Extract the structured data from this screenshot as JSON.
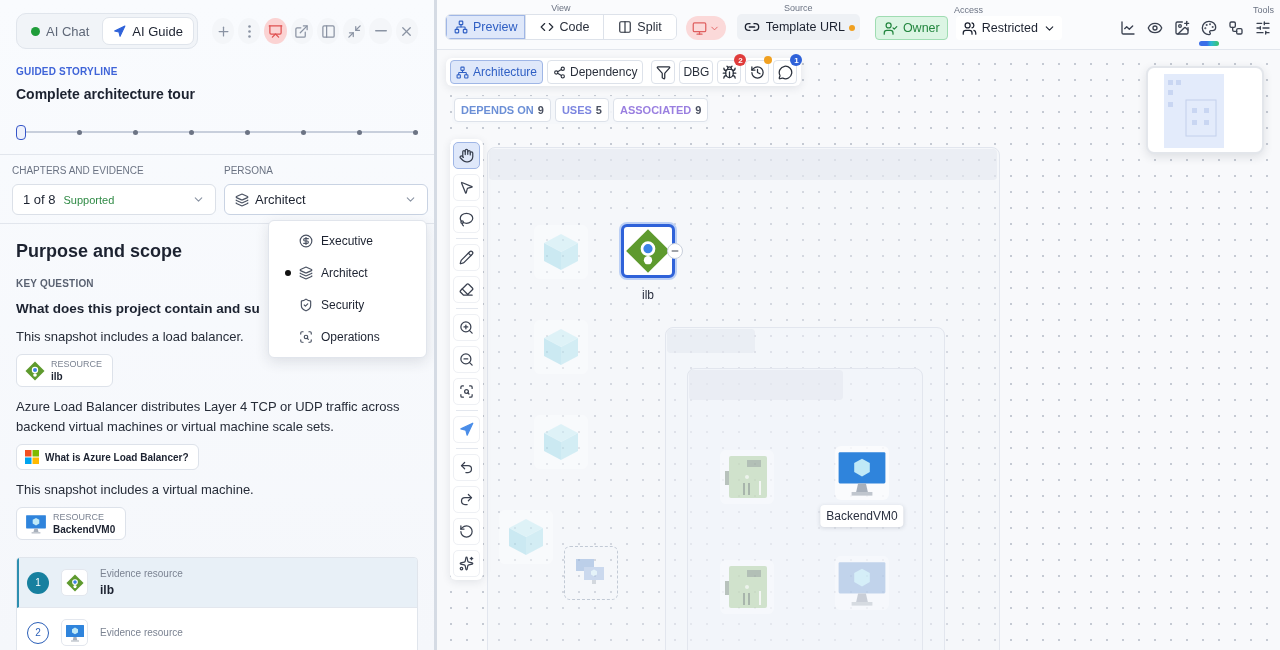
{
  "left_panel": {
    "mode_tabs": [
      {
        "label": "AI Chat",
        "selected": false
      },
      {
        "label": "AI Guide",
        "selected": true
      }
    ],
    "header_actions": [
      {
        "kind": "add",
        "active": false
      },
      {
        "kind": "more",
        "active": false
      },
      {
        "kind": "present",
        "active": true
      },
      {
        "kind": "popout",
        "active": false
      },
      {
        "kind": "panel",
        "active": false
      },
      {
        "kind": "collapse",
        "active": false
      },
      {
        "kind": "minimize",
        "active": false
      },
      {
        "kind": "close",
        "active": false
      }
    ],
    "storyline": {
      "eyebrow": "GUIDED STORYLINE",
      "title": "Complete architecture tour",
      "steps": [
        {
          "selected": true
        },
        {
          "selected": false
        },
        {
          "selected": false
        },
        {
          "selected": false
        },
        {
          "selected": false
        },
        {
          "selected": false
        },
        {
          "selected": false
        },
        {
          "selected": false
        }
      ]
    },
    "chapter_select": {
      "label": "CHAPTERS AND EVIDENCE",
      "value": "1 of 8",
      "status": "Supported"
    },
    "persona_select": {
      "label": "PERSONA",
      "value": "Architect",
      "expanded": true,
      "options": [
        {
          "label": "Executive",
          "kind": "executive",
          "selected": false
        },
        {
          "label": "Architect",
          "kind": "architect",
          "selected": true
        },
        {
          "label": "Security",
          "kind": "security",
          "selected": false
        },
        {
          "label": "Operations",
          "kind": "operations",
          "selected": false
        }
      ]
    },
    "section": {
      "title": "Purpose and scope",
      "eyebrow": "KEY QUESTION",
      "question": "What does this project contain and su",
      "blocks": [
        {
          "kind": "text",
          "text": "This snapshot includes a load balancer."
        },
        {
          "kind": "lb_resource",
          "label": "RESOURCE",
          "name": "ilb"
        },
        {
          "kind": "text",
          "text": "Azure Load Balancer distributes Layer 4 TCP or UDP traffic across backend virtual machines or virtual machine scale sets."
        },
        {
          "kind": "doc_link",
          "text": "What is Azure Load Balancer?"
        },
        {
          "kind": "text",
          "text": "This snapshot includes a virtual machine."
        },
        {
          "kind": "vm_resource",
          "label": "RESOURCE",
          "name": "BackendVM0"
        }
      ]
    },
    "evidence": [
      {
        "number": "1",
        "caption": "Evidence resource",
        "name": "ilb",
        "kind": "lb",
        "selected": true
      },
      {
        "number": "2",
        "caption": "Evidence resource",
        "kind": "vm",
        "selected": false
      }
    ]
  },
  "right_panel": {
    "view": {
      "label": "View",
      "options": [
        {
          "label": "Preview",
          "kind": "preview",
          "selected": true
        },
        {
          "label": "Code",
          "kind": "code",
          "selected": false
        },
        {
          "label": "Split",
          "kind": "split",
          "selected": false
        }
      ]
    },
    "device_preview": {
      "active": true
    },
    "source": {
      "label": "Source",
      "button": "Template URL",
      "unsaved": true
    },
    "access": {
      "label": "Access",
      "role": "Owner",
      "visibility": "Restricted"
    },
    "tools": {
      "label": "Tools",
      "items": [
        {
          "kind": "chart"
        },
        {
          "kind": "eye"
        },
        {
          "kind": "image"
        },
        {
          "kind": "palette"
        },
        {
          "kind": "flow"
        },
        {
          "kind": "sliders"
        }
      ]
    },
    "canvas": {
      "modes": [
        {
          "label": "Architecture",
          "kind": "architecture",
          "selected": true
        },
        {
          "label": "Dependency",
          "kind": "dependency",
          "selected": false
        }
      ],
      "debug_label": "DBG",
      "issue_count": "2",
      "history_pending": true,
      "comment_count": "1",
      "relation_chips": [
        {
          "label": "DEPENDS ON",
          "count": "9",
          "color": "#6b8fd6"
        },
        {
          "label": "USES",
          "count": "5",
          "color": "#7d86e0"
        },
        {
          "label": "ASSOCIATED",
          "count": "9",
          "color": "#9a7fe0"
        }
      ],
      "tools": [
        {
          "kind": "hand",
          "selected": true
        },
        {
          "kind": "pointer",
          "selected": false
        },
        {
          "kind": "lasso",
          "selected": false
        },
        {
          "kind": "pencil",
          "selected": false
        },
        {
          "kind": "eraser",
          "selected": false
        },
        {
          "kind": "zoom_in",
          "selected": false
        },
        {
          "kind": "zoom_out",
          "selected": false
        },
        {
          "kind": "fit",
          "selected": false
        },
        {
          "kind": "navigate",
          "selected": false
        },
        {
          "kind": "undo",
          "selected": false
        },
        {
          "kind": "redo",
          "selected": false
        },
        {
          "kind": "reset",
          "selected": false
        },
        {
          "kind": "magic",
          "selected": false
        }
      ],
      "nodes": [
        {
          "kind": "cube",
          "selected": false,
          "dimmed": true
        },
        {
          "kind": "cube",
          "selected": false,
          "dimmed": true
        },
        {
          "kind": "cube",
          "selected": false,
          "dimmed": true
        },
        {
          "kind": "cube",
          "selected": false,
          "dimmed": true
        },
        {
          "kind": "load_balancer",
          "label": "ilb",
          "selected": true,
          "dimmed": false
        },
        {
          "kind": "nic",
          "selected": false,
          "dimmed": true
        },
        {
          "kind": "nic",
          "selected": false,
          "dimmed": true
        },
        {
          "kind": "vm",
          "label": "BackendVM0",
          "selected": false,
          "dimmed": false
        },
        {
          "kind": "vm",
          "selected": false,
          "dimmed": true
        },
        {
          "kind": "vmss",
          "selected": false,
          "dimmed": true
        }
      ]
    }
  }
}
